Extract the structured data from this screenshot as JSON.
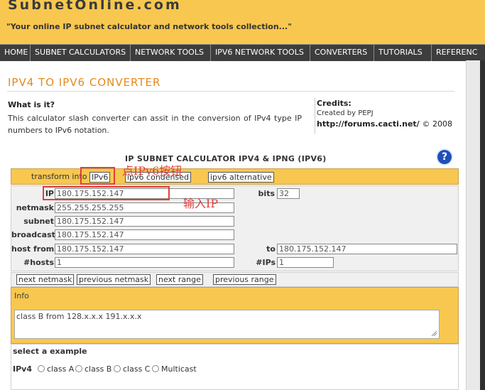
{
  "site": {
    "logo": "SubnetOnline.com",
    "tagline": "\"Your online IP subnet calculator and network tools collection...\""
  },
  "nav": {
    "items": [
      "HOME",
      "SUBNET CALCULATORS",
      "NETWORK TOOLS",
      "IPV6 NETWORK TOOLS",
      "CONVERTERS",
      "TUTORIALS",
      "REFERENC"
    ]
  },
  "page": {
    "title": "IPV4 TO IPV6 CONVERTER",
    "what_heading": "What is it?",
    "description": "This calculator slash converter can assit in the conversion of IPv4 type IP numbers to IPv6 notation.",
    "credits": {
      "title": "Credits:",
      "by": "Created by PEPJ",
      "url": "http://forums.cacti.net/",
      "year": "© 2008"
    }
  },
  "calculator": {
    "title": "IP SUBNET CALCULATOR IPV4 & IPNG (IPV6)",
    "help_glyph": "?",
    "transform_label": "transform into",
    "transform_buttons": [
      "IPv6",
      "ipv6 condensed",
      "ipv6 alternative"
    ],
    "labels": {
      "ip": "IP",
      "bits": "bits",
      "netmask": "netmask",
      "subnet": "subnet",
      "broadcast": "broadcast",
      "host_from": "host from",
      "to": "to",
      "hosts": "#hosts",
      "ips": "#IPs"
    },
    "values": {
      "ip": "180.175.152.147",
      "bits": "32",
      "netmask": "255.255.255.255",
      "subnet": "180.175.152.147",
      "broadcast": "180.175.152.147",
      "host_from": "180.175.152.147",
      "to": "180.175.152.147",
      "hosts": "1",
      "ips": "1"
    },
    "nav_buttons": [
      "next netmask",
      "previous netmask",
      "next range",
      "previous range"
    ],
    "info_label": "Info",
    "info_text": "class B from 128.x.x.x 191.x.x.x",
    "example_title": "select a example",
    "ipv4_label": "IPv4",
    "ipv4_options": [
      "class A",
      "class B",
      "class C",
      "Multicast"
    ]
  },
  "annotations": {
    "click_ipv6": "点IPv6按钮",
    "enter_ip": "输入IP"
  },
  "colors": {
    "header_bg": "#f8c74f",
    "nav_bg": "#3d3d3d",
    "title_orange": "#e38a1c",
    "annotation_red": "#e0403a",
    "help_blue": "#1f4fb8"
  }
}
